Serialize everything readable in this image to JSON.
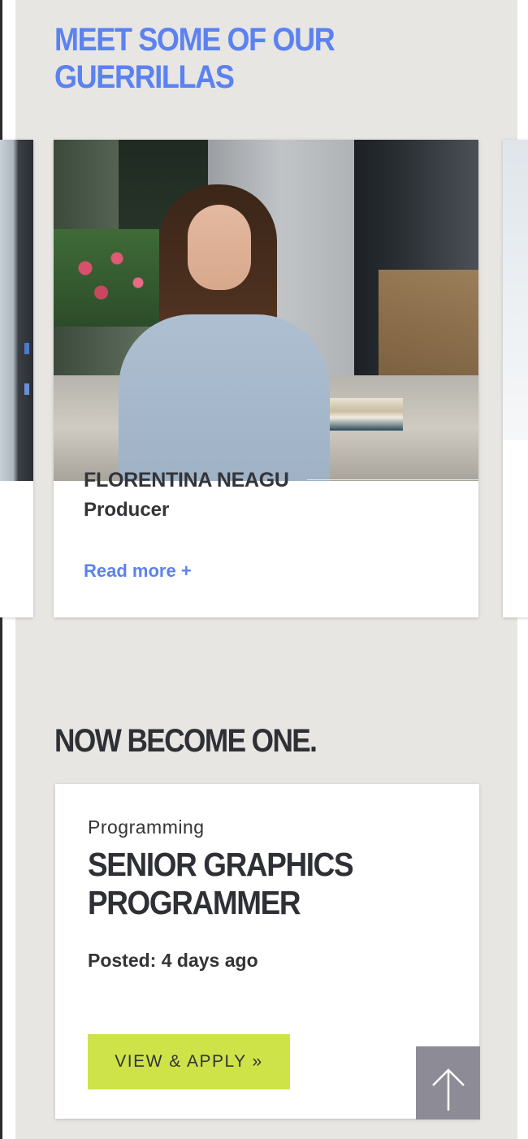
{
  "guerrillas_section": {
    "heading": "MEET SOME OF OUR GUERRILLAS",
    "featured": {
      "name": "FLORENTINA NEAGU",
      "role": "Producer",
      "read_more": "Read more +"
    }
  },
  "jobs_section": {
    "heading": "NOW BECOME ONE.",
    "job": {
      "category": "Programming",
      "title": "SENIOR GRAPHICS PROGRAMMER",
      "posted": "Posted: 4 days ago",
      "apply_label": "VIEW & APPLY »"
    }
  },
  "scroll_top_icon": "arrow-up-icon",
  "colors": {
    "accent_blue": "#5b82f0",
    "apply_green": "#cde348",
    "panel_bg": "#e8e6e3",
    "scroll_button": "#8d8c96"
  }
}
